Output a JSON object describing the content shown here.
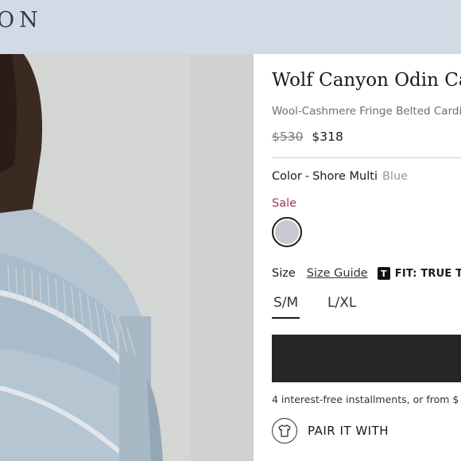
{
  "header": {
    "logo_text": "ON"
  },
  "product": {
    "title": "Wolf Canyon Odin Ca",
    "subtitle": "Wool-Cashmere Fringe Belted Cardi",
    "old_price": "$530",
    "new_price": "$318",
    "color_label": "Color",
    "color_sep": "-",
    "color_value": "Shore Multi",
    "color_family": "Blue",
    "sale_label": "Sale",
    "swatch_color": "#c8c8d2",
    "size_label": "Size",
    "size_guide": "Size Guide",
    "fit_icon_letter": "T",
    "fit_text": "FIT: TRUE TO S",
    "sizes": [
      "S/M",
      "L/XL"
    ],
    "selected_size": "S/M",
    "installments": "4 interest-free installments, or from $",
    "pair_label": "PAIR IT WITH"
  },
  "colors": {
    "header_bg": "#d0dbe6",
    "sale": "#9b3a4f",
    "button": "#262626"
  }
}
